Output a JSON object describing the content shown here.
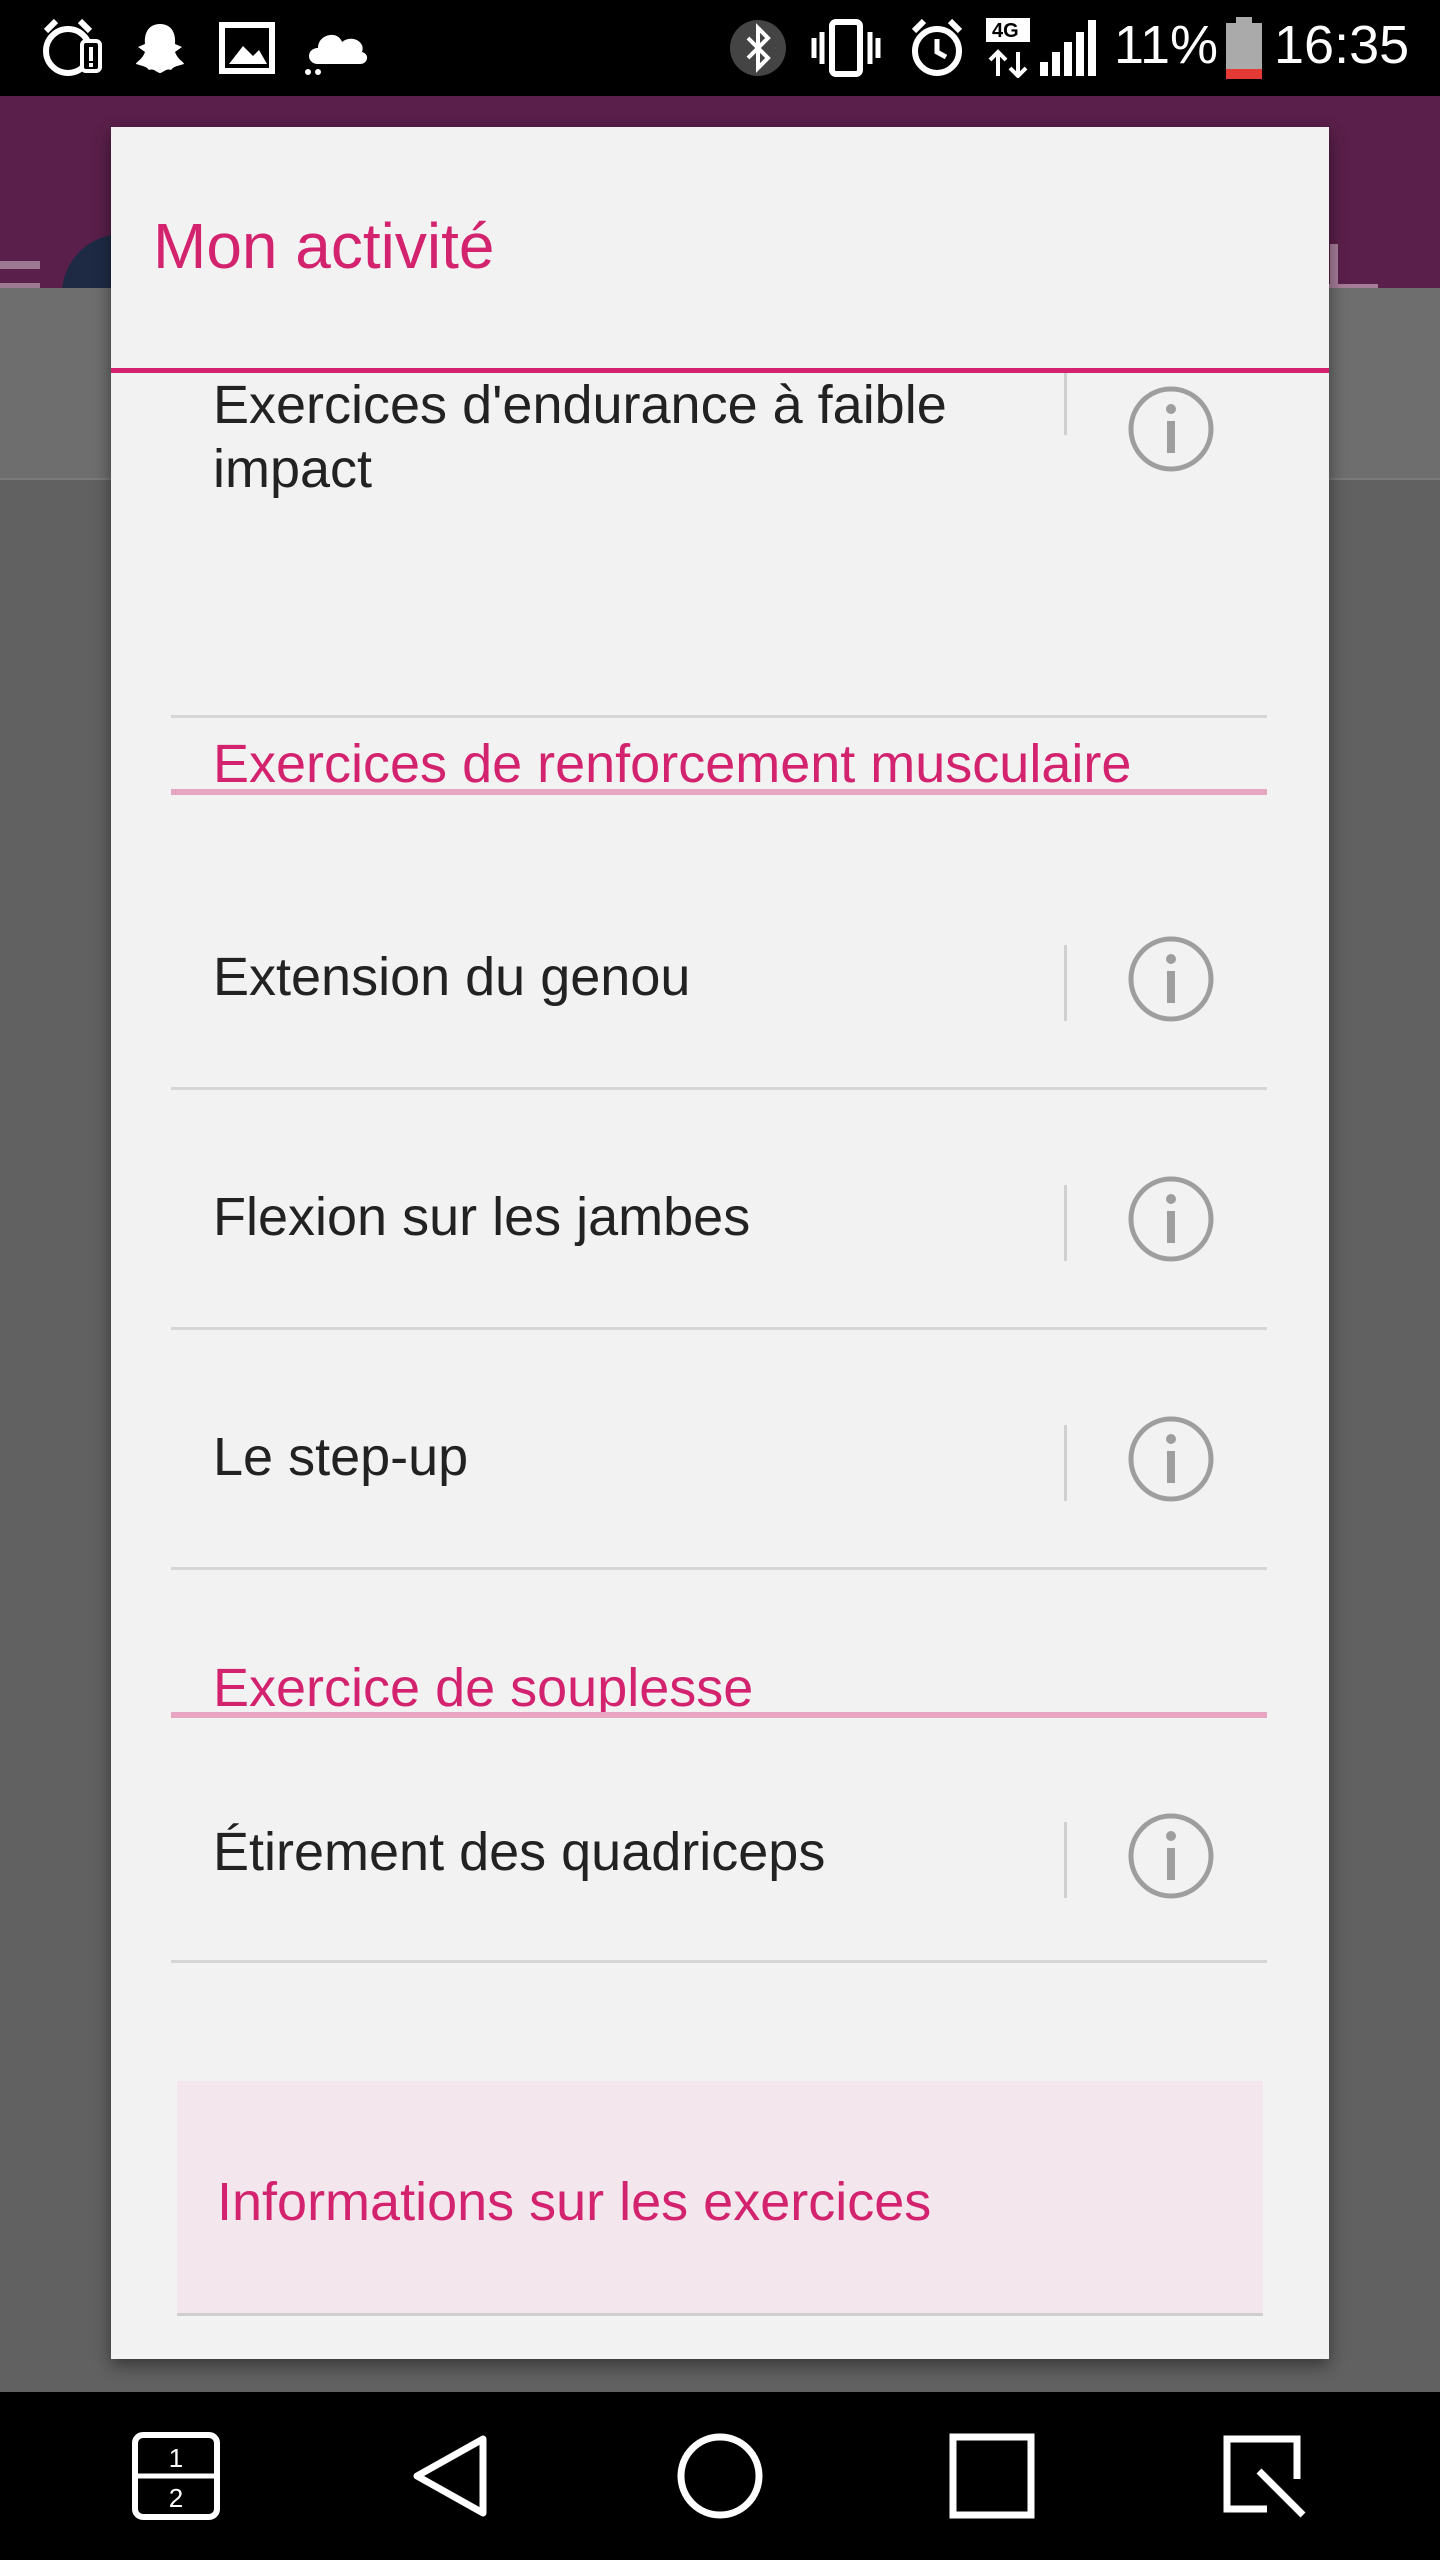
{
  "status_bar": {
    "battery_percent": "11%",
    "time": "16:35",
    "network": "4G",
    "icons": [
      "alarm-warning-icon",
      "snapchat-icon",
      "gallery-icon",
      "cloud-icon",
      "bluetooth-icon",
      "vibrate-icon",
      "alarm-icon",
      "network-4g-icon",
      "signal-icon",
      "battery-icon"
    ]
  },
  "dialog": {
    "title": "Mon activité",
    "items": [
      {
        "label_line1": "Exercices d'endurance à faible",
        "label_line2": "impact"
      },
      {
        "section": "Exercices de renforcement musculaire"
      },
      {
        "label": "Extension du genou"
      },
      {
        "label": "Flexion sur les jambes"
      },
      {
        "label": "Le step-up"
      },
      {
        "section": "Exercice de souplesse"
      },
      {
        "label": "Étirement des quadriceps"
      }
    ],
    "info_button": "Informations sur les exercices"
  },
  "nav_bar": {
    "buttons": [
      "dual-window-icon",
      "back-icon",
      "home-icon",
      "recents-icon",
      "qslide-icon"
    ],
    "dual_window_top": "1",
    "dual_window_bottom": "2"
  },
  "colors": {
    "accent": "#d3236f",
    "section_line": "#e6a6c2",
    "dialog_bg": "#f2f2f2",
    "info_button_bg": "#f3e6ec"
  }
}
